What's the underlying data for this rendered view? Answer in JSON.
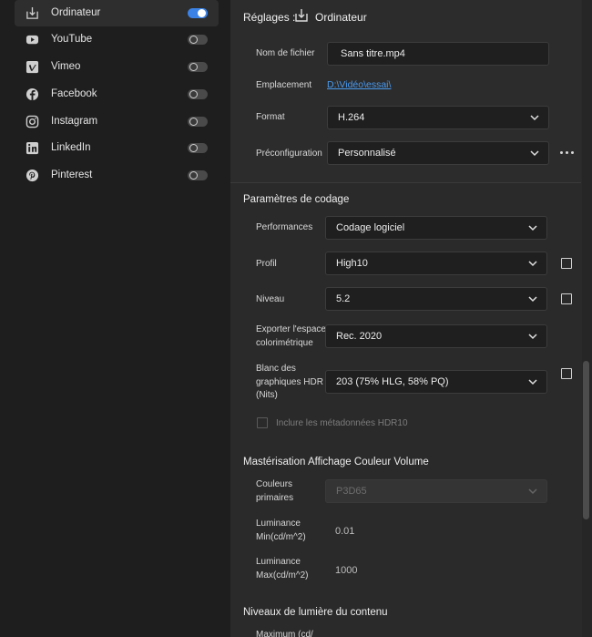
{
  "sidebar": {
    "items": [
      {
        "label": "Ordinateur",
        "icon": "download-to-computer-icon",
        "enabled": true
      },
      {
        "label": "YouTube",
        "icon": "youtube-icon",
        "enabled": false
      },
      {
        "label": "Vimeo",
        "icon": "vimeo-icon",
        "enabled": false
      },
      {
        "label": "Facebook",
        "icon": "facebook-icon",
        "enabled": false
      },
      {
        "label": "Instagram",
        "icon": "instagram-icon",
        "enabled": false
      },
      {
        "label": "LinkedIn",
        "icon": "linkedin-icon",
        "enabled": false
      },
      {
        "label": "Pinterest",
        "icon": "pinterest-icon",
        "enabled": false
      }
    ]
  },
  "header": {
    "title": "Réglages :",
    "destination": "Ordinateur",
    "filename_label": "Nom de fichier",
    "filename_value": "Sans titre.mp4",
    "location_label": "Emplacement",
    "location_value": "D:\\Vidéo\\essai\\",
    "format_label": "Format",
    "format_value": "H.264",
    "preset_label": "Préconfiguration",
    "preset_value": "Personnalisé"
  },
  "encoding": {
    "title": "Paramètres de codage",
    "performance_label": "Performances",
    "performance_value": "Codage logiciel",
    "profile_label": "Profil",
    "profile_value": "High10",
    "level_label": "Niveau",
    "level_value": "5.2",
    "colorspace_label": [
      "Exporter l'espace",
      "colorimétrique"
    ],
    "colorspace_value": "Rec. 2020",
    "hdr_white_label": [
      "Blanc des",
      "graphiques HDR",
      "(Nits)"
    ],
    "hdr_white_value": "203 (75% HLG, 58% PQ)",
    "hdr10_metadata_label": "Inclure les métadonnées HDR10"
  },
  "mastering": {
    "title": "Mastérisation Affichage Couleur Volume",
    "primaries_label": [
      "Couleurs",
      "primaires"
    ],
    "primaries_value": "P3D65",
    "lum_min_label": [
      "Luminance",
      "Min(cd/m^2)"
    ],
    "lum_min_value": "0.01",
    "lum_max_label": [
      "Luminance",
      "Max(cd/m^2)"
    ],
    "lum_max_value": "1000"
  },
  "content_light": {
    "title": "Niveaux de lumière du contenu",
    "max_label": "Maximum (cd/"
  },
  "colors": {
    "accent": "#3b82e6",
    "link": "#4a9af0"
  }
}
